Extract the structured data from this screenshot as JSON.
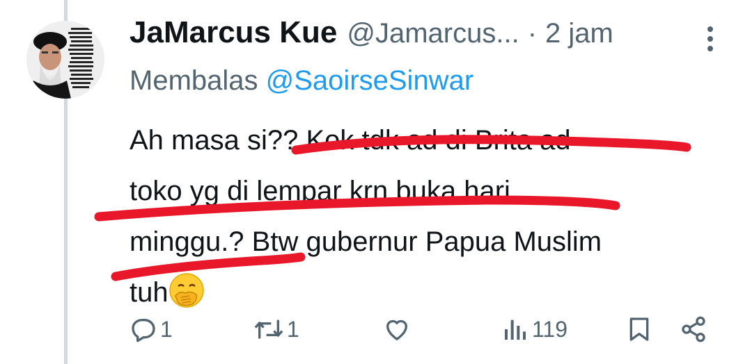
{
  "tweet": {
    "author_name": "JaMarcus Kue",
    "author_handle": "@Jamarcus...",
    "separator": "·",
    "time": "2 jam",
    "reply_prefix": "Membalas",
    "reply_to": "@SaoirseSinwar",
    "text_lines": [
      "Ah masa si?? Kok tdk ad di Brita ad",
      "toko yg di lempar krn buka hari",
      "minggu.? Btw gubernur Papua Muslim",
      "tuh"
    ],
    "emoji": "face-with-hand-over-mouth",
    "annotation_color": "#e8172a"
  },
  "actions": {
    "reply_count": "1",
    "retweet_count": "1",
    "views_count": "119"
  },
  "icons": {
    "more": "more-vertical-icon",
    "reply": "reply-icon",
    "retweet": "retweet-icon",
    "like": "heart-icon",
    "views": "views-icon",
    "bookmark": "bookmark-icon",
    "share": "share-icon"
  },
  "colors": {
    "text": "#0f1419",
    "secondary": "#536471",
    "link": "#1d9bf0",
    "thread_line": "#cfd9de"
  }
}
